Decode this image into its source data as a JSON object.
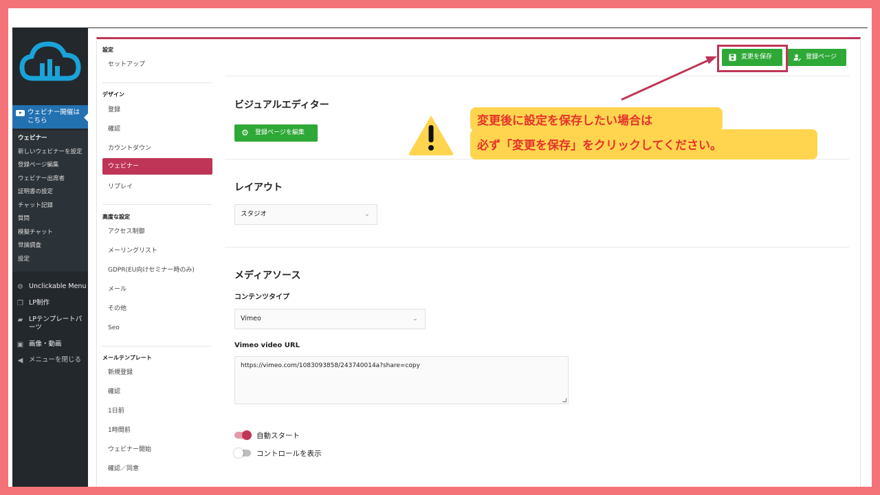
{
  "sidebar": {
    "active_menu": "ウェビナー開催はこちら",
    "submenu": [
      "ウェビナー",
      "新しいウェビナーを設定",
      "登録ページ編集",
      "ウェビナー出席者",
      "証明書の設定",
      "チャット記録",
      "質問",
      "模擬チャット",
      "世論調査",
      "設定"
    ],
    "items": [
      {
        "label": "Unclickable Menu",
        "icon": "gear-icon"
      },
      {
        "label": "LP制作",
        "icon": "pages-icon"
      },
      {
        "label": "LPテンプレートパーツ",
        "icon": "folder-icon"
      },
      {
        "label": "画像・動画",
        "icon": "media-icon"
      },
      {
        "label": "メニューを閉じる",
        "icon": "collapse-icon"
      }
    ]
  },
  "nav": {
    "groups": [
      {
        "title": "設定",
        "items": [
          "セットアップ"
        ]
      },
      {
        "title": "デザイン",
        "items": [
          "登録",
          "確認",
          "カウントダウン",
          "ウェビナー",
          "リプレイ"
        ]
      },
      {
        "title": "高度な設定",
        "items": [
          "アクセス制御",
          "メーリングリスト",
          "GDPR(EU向けセミナー時のみ)",
          "メール",
          "その他",
          "Seo"
        ]
      },
      {
        "title": "メールテンプレート",
        "items": [
          "新規登録",
          "確認",
          "1日前",
          "1時間前",
          "ウェビナー開始",
          "確認／同意"
        ]
      }
    ],
    "active_item": "ウェビナー"
  },
  "header": {
    "save_label": "変更を保存",
    "register_label": "登録ページ"
  },
  "visual_editor": {
    "title": "ビジュアルエディター",
    "edit_button": "登録ページを編集"
  },
  "layout": {
    "title": "レイアウト",
    "selected": "スタジオ"
  },
  "media": {
    "title": "メディアソース",
    "content_type_label": "コンテンツタイプ",
    "content_type_value": "Vimeo",
    "url_label": "Vimeo video URL",
    "url_value": "https://vimeo.com/1083093858/243740014a?share=copy"
  },
  "toggles": [
    {
      "label": "自動スタート",
      "on": true
    },
    {
      "label": "コントロールを表示",
      "on": false
    }
  ],
  "annotation": {
    "line1": "変更後に設定を保存したい場合は",
    "line2": "必ず「変更を保存」をクリックしてください。"
  },
  "colors": {
    "accent": "#be3557",
    "green": "#2ea836",
    "wp_blue": "#2271b1",
    "note_bg": "#ffd54f",
    "note_text": "#e5332a",
    "frame": "#f47379"
  }
}
